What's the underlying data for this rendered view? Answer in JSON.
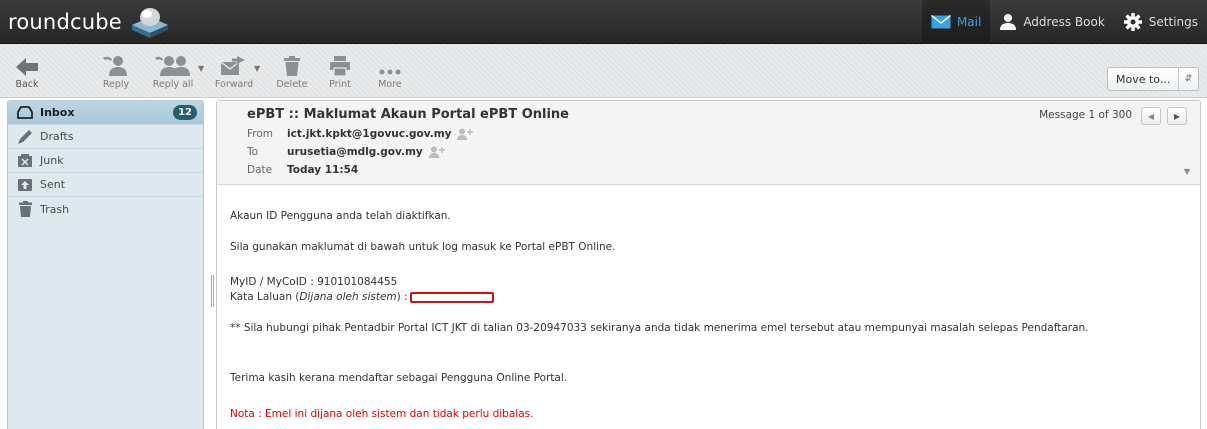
{
  "app": {
    "logo_text": "roundcube"
  },
  "topnav": {
    "mail": "Mail",
    "address_book": "Address Book",
    "settings": "Settings"
  },
  "toolbar": {
    "back": "Back",
    "reply": "Reply",
    "reply_all": "Reply all",
    "forward": "Forward",
    "delete": "Delete",
    "print": "Print",
    "more": "More",
    "move_to": "Move to..."
  },
  "folders": [
    {
      "label": "Inbox",
      "unread": "12",
      "icon": "inbox-icon"
    },
    {
      "label": "Drafts",
      "icon": "drafts-icon"
    },
    {
      "label": "Junk",
      "icon": "junk-icon"
    },
    {
      "label": "Sent",
      "icon": "sent-icon"
    },
    {
      "label": "Trash",
      "icon": "trash-icon"
    }
  ],
  "message": {
    "subject": "ePBT :: Maklumat Akaun Portal ePBT Online",
    "from_label": "From",
    "from": "ict.jkt.kpkt@1govuc.gov.my",
    "to_label": "To",
    "to": "urusetia@mdlg.gov.my",
    "date_label": "Date",
    "date": "Today 11:54",
    "position": "Message 1 of 300",
    "body": {
      "line1": "Akaun ID Pengguna anda telah diaktifkan.",
      "line2": "Sila gunakan maklumat di bawah untuk log masuk ke Portal ePBT Online.",
      "line3": "MyID / MyCoID : 910101084455",
      "line4_prefix": "Kata Laluan (",
      "line4_italic": "Dijana oleh sistem",
      "line4_suffix": ") :",
      "line5": "** Sila hubungi pihak Pentadbir Portal ICT JKT di talian 03-20947033 sekiranya anda tidak menerima emel tersebut atau mempunyai masalah selepas Pendaftaran.",
      "line6": "Terima kasih kerana mendaftar sebagai Pengguna Online Portal.",
      "line7": "Nota : Emel ini dijana oleh sistem dan tidak perlu dibalas."
    }
  },
  "colors": {
    "accent": "#3ca1df",
    "badge": "#23606f",
    "note_red": "#e20000",
    "redaction": "#cc1111"
  }
}
